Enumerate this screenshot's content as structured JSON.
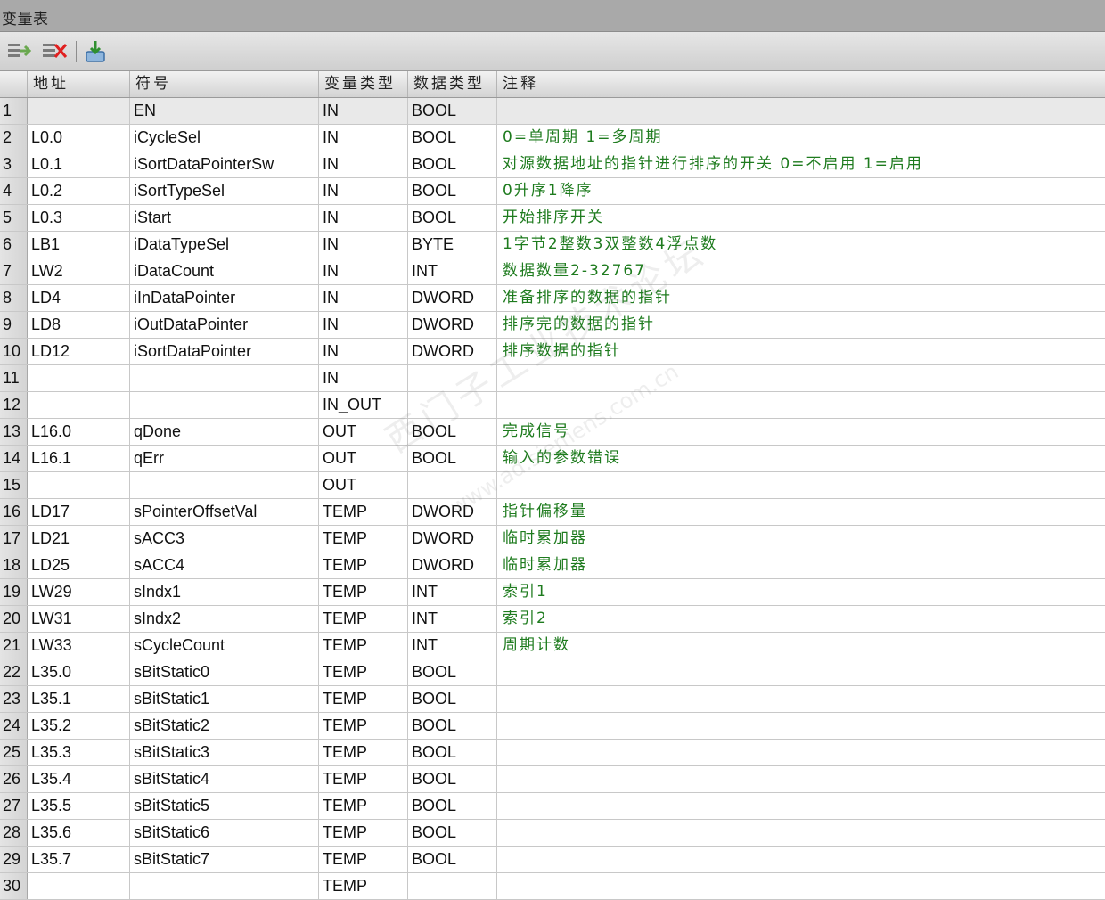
{
  "window": {
    "title": "变量表"
  },
  "toolbar": {
    "buttons": [
      {
        "name": "insert-row-icon"
      },
      {
        "name": "delete-row-icon"
      },
      {
        "name": "download-icon"
      }
    ]
  },
  "table": {
    "headers": [
      "",
      "地址",
      "符号",
      "变量类型",
      "数据类型",
      "注释"
    ],
    "rows": [
      [
        "1",
        "",
        "EN",
        "IN",
        "BOOL",
        ""
      ],
      [
        "2",
        "L0.0",
        "iCycleSel",
        "IN",
        "BOOL",
        "0=单周期 1=多周期"
      ],
      [
        "3",
        "L0.1",
        "iSortDataPointerSw",
        "IN",
        "BOOL",
        "对源数据地址的指针进行排序的开关 0=不启用 1=启用"
      ],
      [
        "4",
        "L0.2",
        "iSortTypeSel",
        "IN",
        "BOOL",
        "0升序1降序"
      ],
      [
        "5",
        "L0.3",
        "iStart",
        "IN",
        "BOOL",
        "开始排序开关"
      ],
      [
        "6",
        "LB1",
        "iDataTypeSel",
        "IN",
        "BYTE",
        "1字节2整数3双整数4浮点数"
      ],
      [
        "7",
        "LW2",
        "iDataCount",
        "IN",
        "INT",
        "数据数量2-32767"
      ],
      [
        "8",
        "LD4",
        "iInDataPointer",
        "IN",
        "DWORD",
        "准备排序的数据的指针"
      ],
      [
        "9",
        "LD8",
        "iOutDataPointer",
        "IN",
        "DWORD",
        "排序完的数据的指针"
      ],
      [
        "10",
        "LD12",
        "iSortDataPointer",
        "IN",
        "DWORD",
        "排序数据的指针"
      ],
      [
        "11",
        "",
        "",
        "IN",
        "",
        ""
      ],
      [
        "12",
        "",
        "",
        "IN_OUT",
        "",
        ""
      ],
      [
        "13",
        "L16.0",
        "qDone",
        "OUT",
        "BOOL",
        "完成信号"
      ],
      [
        "14",
        "L16.1",
        "qErr",
        "OUT",
        "BOOL",
        "输入的参数错误"
      ],
      [
        "15",
        "",
        "",
        "OUT",
        "",
        ""
      ],
      [
        "16",
        "LD17",
        "sPointerOffsetVal",
        "TEMP",
        "DWORD",
        "指针偏移量"
      ],
      [
        "17",
        "LD21",
        "sACC3",
        "TEMP",
        "DWORD",
        "临时累加器"
      ],
      [
        "18",
        "LD25",
        "sACC4",
        "TEMP",
        "DWORD",
        "临时累加器"
      ],
      [
        "19",
        "LW29",
        "sIndx1",
        "TEMP",
        "INT",
        "索引1"
      ],
      [
        "20",
        "LW31",
        "sIndx2",
        "TEMP",
        "INT",
        "索引2"
      ],
      [
        "21",
        "LW33",
        "sCycleCount",
        "TEMP",
        "INT",
        "周期计数"
      ],
      [
        "22",
        "L35.0",
        "sBitStatic0",
        "TEMP",
        "BOOL",
        ""
      ],
      [
        "23",
        "L35.1",
        "sBitStatic1",
        "TEMP",
        "BOOL",
        ""
      ],
      [
        "24",
        "L35.2",
        "sBitStatic2",
        "TEMP",
        "BOOL",
        ""
      ],
      [
        "25",
        "L35.3",
        "sBitStatic3",
        "TEMP",
        "BOOL",
        ""
      ],
      [
        "26",
        "L35.4",
        "sBitStatic4",
        "TEMP",
        "BOOL",
        ""
      ],
      [
        "27",
        "L35.5",
        "sBitStatic5",
        "TEMP",
        "BOOL",
        ""
      ],
      [
        "28",
        "L35.6",
        "sBitStatic6",
        "TEMP",
        "BOOL",
        ""
      ],
      [
        "29",
        "L35.7",
        "sBitStatic7",
        "TEMP",
        "BOOL",
        ""
      ],
      [
        "30",
        "",
        "",
        "TEMP",
        "",
        ""
      ]
    ]
  },
  "watermark": {
    "text": "西门子工业技术论坛",
    "url_text": "www.ad.siemens.com.cn"
  },
  "colors": {
    "comment": "#1e7b1e",
    "titlebar": "#a9a9a9"
  }
}
